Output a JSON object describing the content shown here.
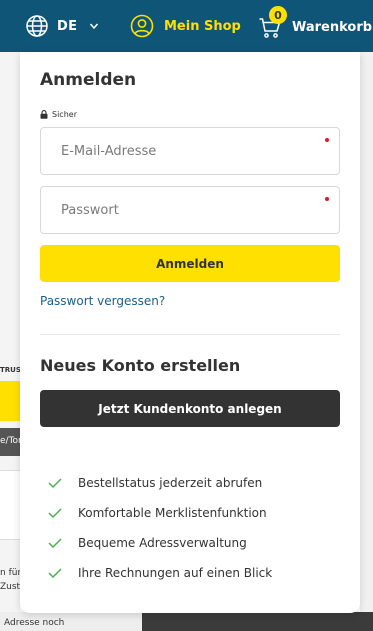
{
  "header": {
    "language_code": "DE",
    "shop_label": "Mein Shop",
    "cart_label": "Warenkorb",
    "cart_count": "0"
  },
  "login": {
    "title": "Anmelden",
    "secure_label": "Sicher",
    "email_placeholder": "E-Mail-Adresse",
    "password_placeholder": "Passwort",
    "submit_label": "Anmelden",
    "forgot_link": "Passwort vergessen?"
  },
  "register": {
    "title": "Neues Konto erstellen",
    "button_label": "Jetzt Kundenkonto anlegen",
    "benefits": [
      "Bestellstatus jederzeit abrufen",
      "Komfortable Merklistenfunktion",
      "Bequeme Adressverwaltung",
      "Ihre Rechnungen auf einen Blick"
    ]
  },
  "background": {
    "trust_text": "TRUST",
    "dark_bar_text": "e/Ton",
    "side_text_1": "n für V",
    "side_text_2": "Zuste",
    "bottom_text": "Adresse noch"
  },
  "colors": {
    "header_bg": "#0f5577",
    "accent_yellow": "#ffe000",
    "dark_button": "#333333",
    "link_blue": "#1a5f8a",
    "required_red": "#e0182d",
    "check_green": "#4caf50"
  },
  "icons": {
    "language": "globe-icon",
    "shop": "user-icon",
    "cart": "cart-icon",
    "secure": "lock-icon",
    "benefit": "check-icon"
  }
}
